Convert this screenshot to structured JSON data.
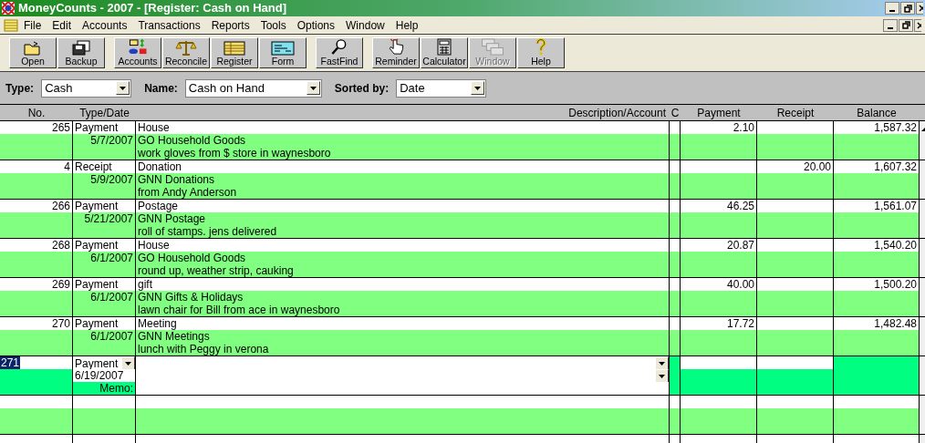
{
  "window": {
    "title": "MoneyCounts - 2007 - [Register: Cash on Hand]"
  },
  "menu": [
    "File",
    "Edit",
    "Accounts",
    "Transactions",
    "Reports",
    "Tools",
    "Options",
    "Window",
    "Help"
  ],
  "toolbar": [
    [
      {
        "label": "Open",
        "disabled": false
      },
      {
        "label": "Backup",
        "disabled": false
      }
    ],
    [
      {
        "label": "Accounts",
        "disabled": false
      },
      {
        "label": "Reconcile",
        "disabled": false
      },
      {
        "label": "Register",
        "disabled": false
      },
      {
        "label": "Form",
        "disabled": false
      }
    ],
    [
      {
        "label": "FastFind",
        "disabled": false
      }
    ],
    [
      {
        "label": "Reminder",
        "disabled": false
      },
      {
        "label": "Calculator",
        "disabled": false
      },
      {
        "label": "Window",
        "disabled": true
      },
      {
        "label": "Help",
        "disabled": false
      }
    ]
  ],
  "filters": [
    {
      "label": "Type:",
      "value": "Cash"
    },
    {
      "label": "Name:",
      "value": "Cash on Hand"
    },
    {
      "label": "Sorted by:",
      "value": "Date"
    }
  ],
  "columns": [
    "No.",
    "Type/Date",
    "Description/Account",
    "C",
    "Payment",
    "Receipt",
    "Balance"
  ],
  "transactions": [
    {
      "no": "265",
      "type": "Payment",
      "date": "5/7/2007",
      "description": "House",
      "account": "GO Household Goods",
      "memo": "work gloves from $ store in waynesboro",
      "payment": "2.10",
      "balance": "1,587.32"
    },
    {
      "no": "4",
      "type": "Receipt",
      "date": "5/9/2007",
      "description": "Donation",
      "account": "GNN Donations",
      "memo": "from Andy Anderson",
      "receipt": "20.00",
      "balance": "1,607.32"
    },
    {
      "no": "266",
      "type": "Payment",
      "date": "5/21/2007",
      "description": "Postage",
      "account": "GNN Postage",
      "memo": "roll of stamps. jens delivered",
      "payment": "46.25",
      "balance": "1,561.07"
    },
    {
      "no": "268",
      "type": "Payment",
      "date": "6/1/2007",
      "description": "House",
      "account": "GO Household Goods",
      "memo": "round up, weather strip, cauking",
      "payment": "20.87",
      "balance": "1,540.20"
    },
    {
      "no": "269",
      "type": "Payment",
      "date": "6/1/2007",
      "description": "gift",
      "account": "GNN Gifts & Holidays",
      "memo": "lawn chair for Bill from ace in waynesboro",
      "payment": "40.00",
      "balance": "1,500.20"
    },
    {
      "no": "270",
      "type": "Payment",
      "date": "6/1/2007",
      "description": "Meeting",
      "account": "GNN Meetings",
      "memo": "lunch with Peggy in verona",
      "payment": "17.72",
      "balance": "1,482.48"
    }
  ],
  "new_entry": {
    "no": "271",
    "no_selected": true,
    "type": "Payment",
    "date": "6/19/2007",
    "memo_label": "Memo:"
  }
}
